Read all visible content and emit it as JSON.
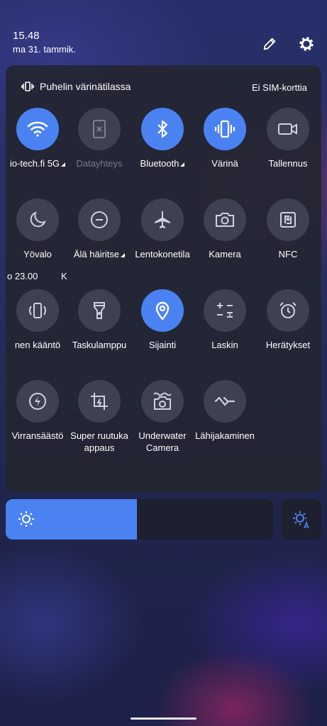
{
  "status": {
    "time": "15.48",
    "date": "ma 31. tammik."
  },
  "header": {
    "edit_icon": "pencil-icon",
    "settings_icon": "gear-icon"
  },
  "panel": {
    "mode_label": "Puhelin värinätilassa",
    "sim_label": "Ei SIM-korttia",
    "accent_color": "#4a82f2",
    "tiles": [
      {
        "icon": "wifi-icon",
        "label": "io-tech.fi 5G",
        "active": true
      },
      {
        "icon": "mobile-data-icon",
        "label": "Datayhteys",
        "active": false
      },
      {
        "icon": "bluetooth-icon",
        "label": "Bluetooth",
        "active": true
      },
      {
        "icon": "vibrate-icon",
        "label": "Värinä",
        "active": true
      },
      {
        "icon": "screen-record-icon",
        "label": "Tallennus",
        "active": false
      },
      {
        "icon": "moon-icon",
        "label": "Yövalo",
        "active": false
      },
      {
        "icon": "do-not-disturb-icon",
        "label": "Älä häiritse",
        "active": false
      },
      {
        "icon": "airplane-icon",
        "label": "Lentokonetila",
        "active": false
      },
      {
        "icon": "camera-icon",
        "label": "Kamera",
        "active": false
      },
      {
        "icon": "nfc-icon",
        "label": "NFC",
        "active": false
      },
      {
        "icon": "auto-rotate-icon",
        "label": "nen kääntö",
        "active": false
      },
      {
        "icon": "flashlight-icon",
        "label": "Taskulamppu",
        "active": false
      },
      {
        "icon": "location-icon",
        "label": "Sijainti",
        "active": true
      },
      {
        "icon": "calculator-icon",
        "label": "Laskin",
        "active": false
      },
      {
        "icon": "alarm-icon",
        "label": "Herätykset",
        "active": false
      },
      {
        "icon": "battery-saver-icon",
        "label": "Virransäästö",
        "active": false
      },
      {
        "icon": "screenshot-icon",
        "label": "Super ruutuka appaus",
        "active": false
      },
      {
        "icon": "underwater-camera-icon",
        "label": "Underwater Camera",
        "active": false
      },
      {
        "icon": "nearby-share-icon",
        "label": "Lähijakaminen",
        "active": false
      }
    ],
    "night_light_sub": "o 23.00",
    "night_light_sub2": "K"
  },
  "brightness": {
    "level_percent": 49,
    "icon": "sun-icon",
    "auto_icon": "auto-brightness-icon"
  }
}
